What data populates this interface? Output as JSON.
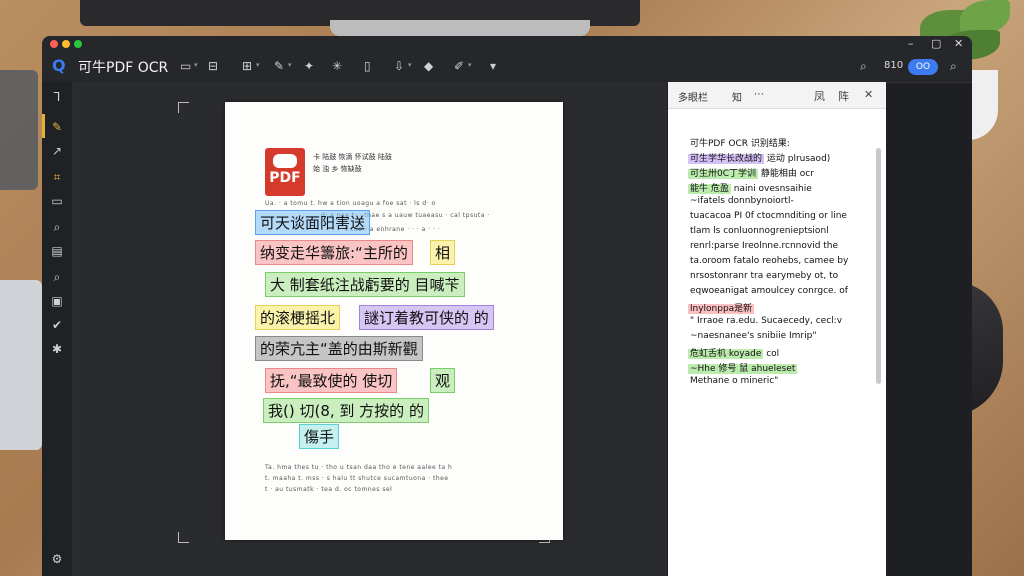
{
  "app": {
    "title": "可牛PDF OCR",
    "logo_glyph": "Q",
    "accent": "#3d7cf0"
  },
  "toolbar": {
    "icons": [
      "folder-icon",
      "save-icon",
      "grid-icon",
      "magic-wand-icon",
      "stamp-icon",
      "sparkle-icon",
      "document-icon",
      "export-icon",
      "diamond-icon",
      "pen-icon"
    ],
    "right_text": "810",
    "toggle_text": "OO",
    "glyphs": {
      "folder": "▭",
      "save": "⊟",
      "grid": "⊞",
      "wand": "✎",
      "stamp": "✦",
      "sparkle": "✳",
      "doc": "▯",
      "export": "⇩",
      "diamond": "◆",
      "pen": "✐",
      "search": "⌕",
      "caret": "▾"
    }
  },
  "sidebar": {
    "top_glyph": "Ꞁ",
    "glyphs": [
      "✎",
      "↗",
      "⌗",
      "▭",
      "⌕",
      "▤",
      "⌕",
      "▣",
      "✔",
      "✱"
    ],
    "bottom_glyph": "⚙"
  },
  "document": {
    "logo_text": "PDF",
    "header_lines": [
      "卡 陆鼓 恢滴 怀试鼓 陆鼓",
      "始 浊 乡 恢缺鼓"
    ],
    "top_lines": [
      "Ua.  ·  a  tomu  t.  hw a  tion  uoagu  a  foe  sat  ·  ls  d·  o",
      "d·  a  naa  t·  · thae  s  a  uauw  tuaeasu  ·  cal  tpsuta  ·",
      "t  cue  ·  a  enhrane  · · ·  a  ·  · ·"
    ],
    "highlights": [
      {
        "text": "可天谈面阳害送",
        "color": "blue"
      },
      {
        "text": "纳变走华籌旅:“主所的",
        "color": "red"
      },
      {
        "text": "相",
        "color": "yellow"
      },
      {
        "text": "大 制套纸注战虧要的 目喊苄",
        "color": "green"
      },
      {
        "text": "的滚梗摇北",
        "color": "yellow"
      },
      {
        "text": "謎订着教可侠的 的",
        "color": "purple"
      },
      {
        "text": "的荣亢主“盖的由斯新觀",
        "color": "gray"
      },
      {
        "text": "抚,“最致使的 使切",
        "color": "red"
      },
      {
        "text": "观",
        "color": "green"
      },
      {
        "text": "我() 切(8, 到 方按的 的",
        "color": "green"
      },
      {
        "text": "傷手",
        "color": "teal"
      }
    ],
    "bottom_lines": [
      "Ta.  hma  thes  tu  ·  tho  u  tsan  daa  tho  e  tene  aalee  ta  h",
      "t.  maaha  t.  mss  ·  s  halu  tt  shutce  sucamtuona  ·  thee",
      "t  ·  au  tusmatk  ·  tea  d.  oc  tomnes  sel"
    ]
  },
  "panel": {
    "header_title": "多眼栏",
    "header_mid": "知",
    "header_menu": "⋯",
    "header_icons": [
      "history-icon",
      "layout-icon",
      "close-icon"
    ],
    "header_glyphs": [
      "凤",
      "阵",
      "✕"
    ],
    "lines": [
      {
        "text": "可牛PDF OCR 识别结果:",
        "hl": ""
      },
      {
        "text": "可生学华长改战的",
        "hl": "purple",
        "rest": " 运动 plrusaod)"
      },
      {
        "text": "可生卅0C丁学训",
        "hl": "green",
        "rest": " 静能相由 ocr"
      },
      {
        "text": "能牛 危盈",
        "hl": "green",
        "rest": " naini ovesnsaihie"
      },
      {
        "text": "~ifatels donnbynoiortl-",
        "hl": ""
      },
      {
        "text": "tuacacoa  PI 0f ctocmnditing or line",
        "hl": ""
      },
      {
        "text": "tlam  ls  conluonnogrenieptsionl",
        "hl": ""
      },
      {
        "text": "renrl:parse  Ireolnne.rcnnovid the",
        "hl": ""
      },
      {
        "text": "ta.oroom  fatalo reohebs, camee by",
        "hl": ""
      },
      {
        "text": "nrsostonranr tra earymeby ot, to",
        "hl": ""
      },
      {
        "text": "eqwoeanigat amoulcey conrgce. of",
        "hl": ""
      },
      {
        "text": "lnylonppa是新",
        "hl": "red",
        "rest": ""
      },
      {
        "text": "\" Irraoe ra.edu. Sucaecedy, cecl:v",
        "hl": ""
      },
      {
        "text": "~naesnanee's  snibiie Imrip\"",
        "hl": ""
      },
      {
        "text": "危虹舌机 koyade",
        "hl": "green",
        "rest": " col"
      },
      {
        "text": "~Hhe 修号 鼠 ahueleset",
        "hl": "green",
        "rest": ""
      },
      {
        "text": "Methane o mineric\"",
        "hl": ""
      }
    ]
  },
  "colors": {
    "window_bg": "#1e1f22",
    "canvas_bg": "#2a2b2e",
    "panel_bg": "#ffffff",
    "sidebar_active": "#e0b33b"
  }
}
